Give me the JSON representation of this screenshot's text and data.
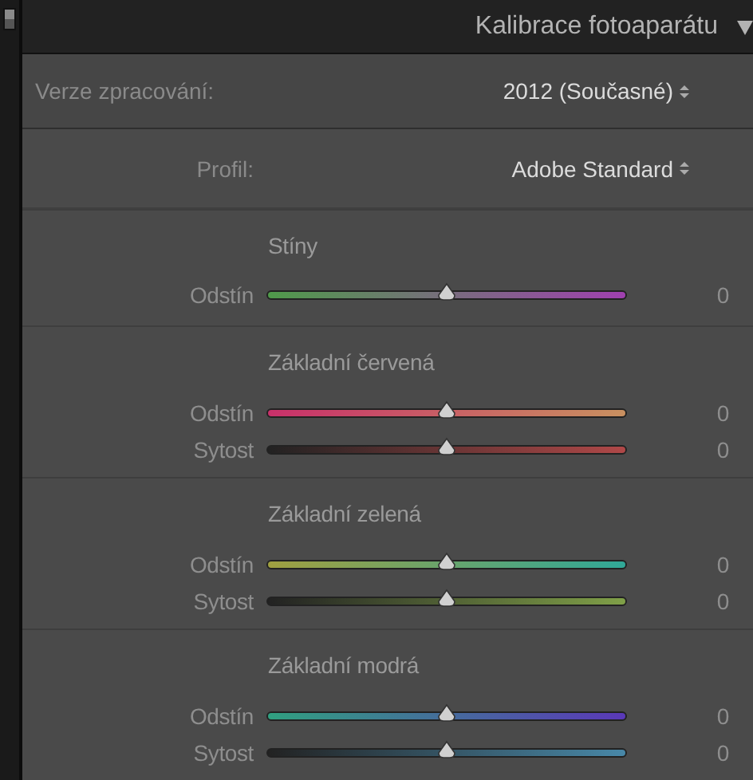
{
  "panel_switch": {
    "on": true
  },
  "header": {
    "title": "Kalibrace fotoaparátu",
    "expanded": true
  },
  "settings": [
    {
      "label": "Verze zpracování:",
      "value": "2012 (Současné)",
      "kind": "dropdown"
    },
    {
      "label": "Profil:",
      "value": "Adobe Standard",
      "kind": "dropdown"
    }
  ],
  "sections": [
    {
      "title": "Stíny",
      "sliders": [
        {
          "label": "Odstín",
          "level": 0.5,
          "reading": "0",
          "kind": "tint"
        }
      ]
    },
    {
      "title": "Základní červená",
      "sliders": [
        {
          "label": "Odstín",
          "level": 0.5,
          "reading": "0",
          "kind": "red-hue"
        },
        {
          "label": "Sytost",
          "level": 0.5,
          "reading": "0",
          "kind": "red-saturation"
        }
      ]
    },
    {
      "title": "Základní zelená",
      "sliders": [
        {
          "label": "Odstín",
          "level": 0.5,
          "reading": "0",
          "kind": "green-hue"
        },
        {
          "label": "Sytost",
          "level": 0.5,
          "reading": "0",
          "kind": "green-saturation"
        }
      ]
    },
    {
      "title": "Základní modrá",
      "sliders": [
        {
          "label": "Odstín",
          "level": 0.5,
          "reading": "0",
          "kind": "blue-hue"
        },
        {
          "label": "Sytost",
          "level": 0.5,
          "reading": "0",
          "kind": "blue-saturation"
        }
      ]
    }
  ]
}
